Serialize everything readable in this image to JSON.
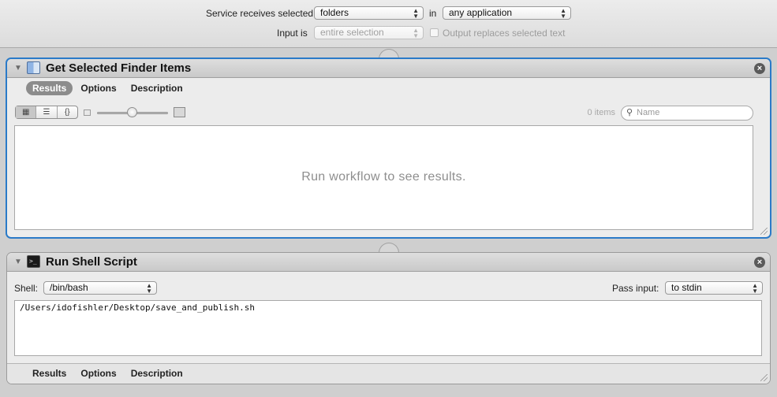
{
  "header": {
    "receives_label": "Service receives selected",
    "receives_value": "folders",
    "in_label": "in",
    "app_value": "any application",
    "input_label": "Input is",
    "input_value": "entire selection",
    "output_replaces_label": "Output replaces selected text"
  },
  "action1": {
    "title": "Get Selected Finder Items",
    "tabs": [
      "Results",
      "Options",
      "Description"
    ],
    "active_tab": "Results",
    "view_modes": [
      "icon-view",
      "list-view",
      "code-view"
    ],
    "item_count": "0 items",
    "search_placeholder": "Name",
    "results_message": "Run workflow to see results."
  },
  "action2": {
    "title": "Run Shell Script",
    "shell_label": "Shell:",
    "shell_value": "/bin/bash",
    "pass_input_label": "Pass input:",
    "pass_input_value": "to stdin",
    "script": "/Users/idofishler/Desktop/save_and_publish.sh",
    "tabs": [
      "Results",
      "Options",
      "Description"
    ]
  },
  "colors": {
    "selection_blue": "#2a7ac8",
    "panel_bg": "#ececec",
    "window_bg": "#cfcfcf"
  }
}
